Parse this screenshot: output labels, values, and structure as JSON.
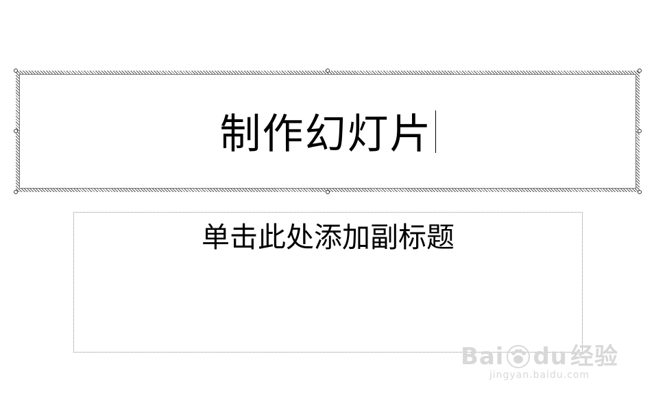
{
  "slide": {
    "title": "制作幻灯片",
    "subtitle_placeholder": "单击此处添加副标题"
  },
  "watermark": {
    "brand": "Bai",
    "brand_suffix": "du",
    "product": "经验",
    "url": "jingyan.baidu.com",
    "icon": "paw-icon"
  }
}
